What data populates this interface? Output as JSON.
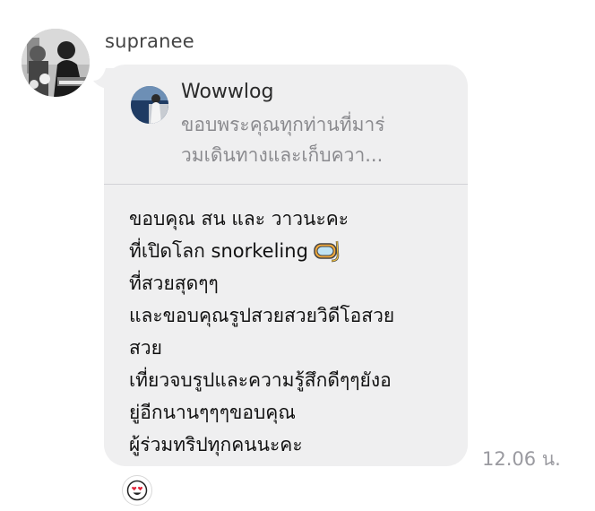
{
  "sender": {
    "name": "supranee",
    "avatar_icon": "profile-photo-grayscale"
  },
  "reply_preview": {
    "title": "Wowwlog",
    "snippet": "ขอบพระคุณทุกท่านที่มาร่วมเดินทางและเก็บควา...",
    "snippet_lines": [
      "ขอบพระคุณทุกท่านที่มาร่",
      "วมเดินทางและเก็บควา..."
    ],
    "avatar_icon": "profile-photo-sea"
  },
  "message": {
    "lines": [
      "ขอบคุณ สน และ วาวนะคะ",
      "ที่เปิดโลก snorkeling",
      "ที่สวยสุดๆๆ",
      "และขอบคุณรูปสวยสวยวิดีโอสวย",
      "สวย",
      "เที่ยวจบรูปและความรู้สึกดีๆๆยังอ",
      "ยู่อีกนานๆๆๆขอบคุณ",
      "ผู้ร่วมทริปทุกคนนะคะ"
    ],
    "inline_icon": "snorkel-mask-icon"
  },
  "timestamp": "12.06 น.",
  "reaction": {
    "icon": "heart-eyes-emoji"
  },
  "colors": {
    "bubble": "#efeff0",
    "text": "#111111",
    "muted": "#8a8a8e",
    "timestamp": "#9a9aa0",
    "reaction_heart": "#e0243a"
  }
}
